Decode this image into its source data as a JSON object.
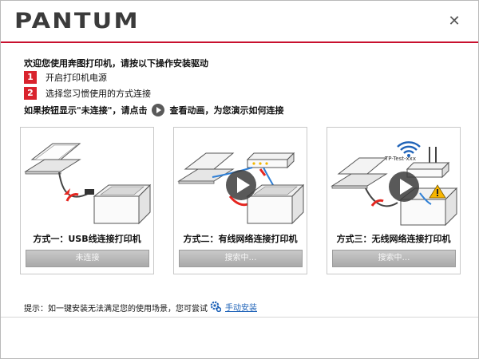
{
  "app": {
    "logo_text": "PANTUM",
    "close_glyph": "✕"
  },
  "colors": {
    "accent": "#c8102e",
    "step_badge": "#d9232d",
    "link": "#1f63b8",
    "disabled_button": "#b5b5b5"
  },
  "intro": {
    "welcome": "欢迎您使用奔图打印机，请按以下操作安装驱动",
    "steps": [
      {
        "num": "1",
        "text": "开启打印机电源"
      },
      {
        "num": "2",
        "text": "选择您习惯使用的方式连接"
      }
    ],
    "hint_before": "如果按钮显示\"未连接\"，请点击",
    "hint_after": "查看动画，为您演示如何连接"
  },
  "cards": [
    {
      "caption": "方式一：USB线连接打印机",
      "button": "未连接",
      "icon": "usb-printer-illustration"
    },
    {
      "caption": "方式二：有线网络连接打印机",
      "button": "搜索中…",
      "icon": "wired-network-printer-illustration"
    },
    {
      "caption": "方式三：无线网络连接打印机",
      "button": "搜索中…",
      "icon": "wireless-network-printer-illustration",
      "router_label": "TP-Test-xxx"
    }
  ],
  "footer": {
    "tip": "提示：如一键安装无法满足您的使用场景，您可尝试",
    "manual_install": "手动安装",
    "manual_icon": "gear-icon"
  }
}
